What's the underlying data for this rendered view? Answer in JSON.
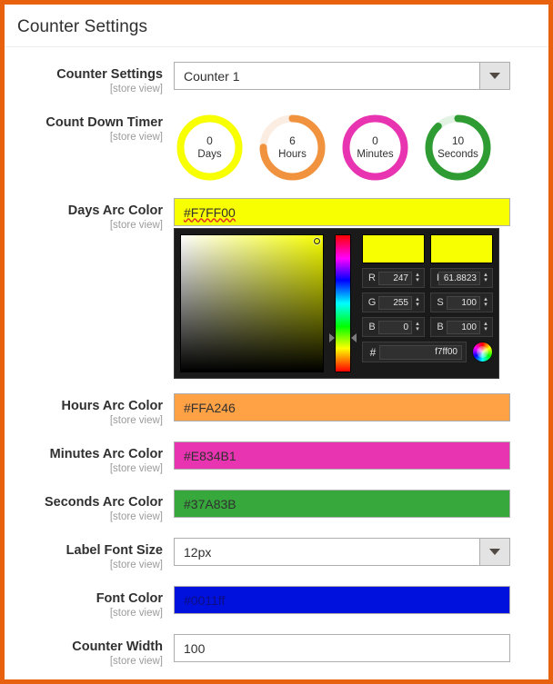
{
  "theme": {
    "frame_border": "#E8610F",
    "page_bg": "#FFFFFF"
  },
  "header": {
    "title": "Counter Settings"
  },
  "scope_label": "[store view]",
  "fields": {
    "counter_settings": {
      "label": "Counter Settings",
      "type": "select",
      "value": "Counter 1",
      "icon": "chevron-down-icon"
    },
    "count_down_timer": {
      "label": "Count Down Timer",
      "type": "rings"
    },
    "days_arc_color": {
      "label": "Days Arc Color",
      "value": "#F7FF00",
      "swatch": "#F7FF00"
    },
    "hours_arc_color": {
      "label": "Hours Arc Color",
      "value": "#FFA246",
      "swatch": "#FFA246"
    },
    "minutes_arc_color": {
      "label": "Minutes Arc Color",
      "value": "#E834B1",
      "swatch": "#E834B1"
    },
    "seconds_arc_color": {
      "label": "Seconds Arc Color",
      "value": "#37A83B",
      "swatch": "#37A83B"
    },
    "label_font_size": {
      "label": "Label Font Size",
      "type": "select",
      "value": "12px",
      "icon": "chevron-down-icon"
    },
    "font_color": {
      "label": "Font Color",
      "value": "#0011ff",
      "swatch": "#0011DD"
    },
    "counter_width": {
      "label": "Counter Width",
      "value": "100"
    }
  },
  "countdown": {
    "units": [
      {
        "name": "days",
        "value": "0",
        "unit_label": "Days",
        "color": "#F7FF00",
        "track": "#F9FFD9",
        "percent": 100
      },
      {
        "name": "hours",
        "value": "6",
        "unit_label": "Hours",
        "color": "#F0923E",
        "track": "#FBEDE2",
        "percent": 75
      },
      {
        "name": "minutes",
        "value": "0",
        "unit_label": "Minutes",
        "color": "#E834B1",
        "track": "#FBE2F3",
        "percent": 100
      },
      {
        "name": "seconds",
        "value": "10",
        "unit_label": "Seconds",
        "color": "#2E9B33",
        "track": "#E2F3E3",
        "percent": 88
      }
    ]
  },
  "color_picker": {
    "selected_hex_display": "f7ff00",
    "selected_color": "#F7FF00",
    "new_swatch": "#F7FF00",
    "current_swatch": "#F7FF00",
    "hex_key": "#",
    "rgb": [
      {
        "key": "R",
        "value": "247"
      },
      {
        "key": "G",
        "value": "255"
      },
      {
        "key": "B",
        "value": "0"
      }
    ],
    "hsb": [
      {
        "key": "H",
        "value": "61.8823"
      },
      {
        "key": "S",
        "value": "100"
      },
      {
        "key": "B",
        "value": "100"
      }
    ],
    "wheel_icon": "color-wheel-icon",
    "spinner_up": "▴",
    "spinner_down": "▾"
  }
}
